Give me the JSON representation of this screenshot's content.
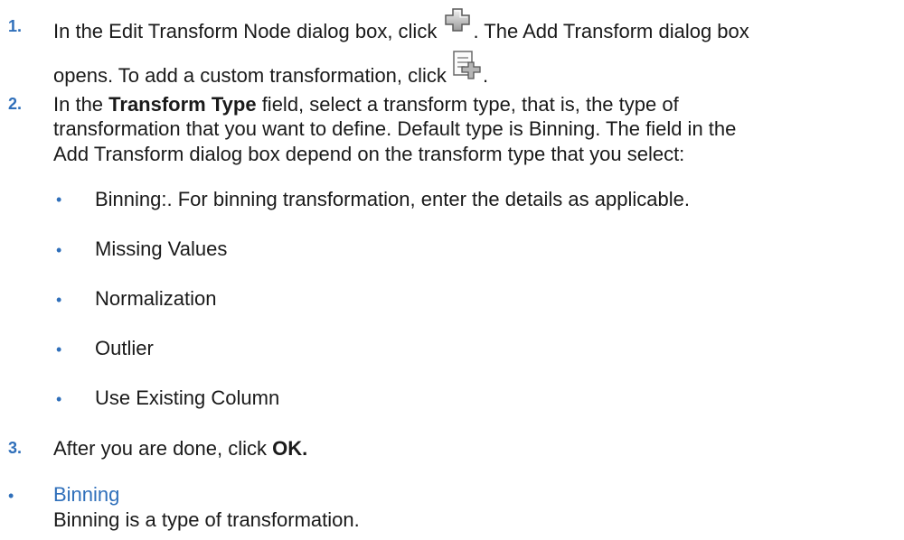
{
  "steps": [
    {
      "num": "1.",
      "line1_a": "In the Edit Transform Node dialog box, click ",
      "line1_b": ". The Add Transform dialog box",
      "line2_a": "opens. To add a custom transformation, click ",
      "line2_b": "."
    },
    {
      "num": "2.",
      "line1_a": "In the ",
      "line1_bold": "Transform Type",
      "line1_b": " field, select a transform type, that is, the type of",
      "line2": "transformation that you want to define. Default type is Binning. The field in the",
      "line3": "Add Transform dialog box depend on the transform type that you select:",
      "bullets": [
        "Binning:. For binning transformation, enter the details as applicable.",
        "Missing Values",
        "Normalization",
        "Outlier",
        "Use Existing Column"
      ]
    },
    {
      "num": "3.",
      "text_a": "After you are done, click ",
      "text_bold": "OK."
    }
  ],
  "related": {
    "link": "Binning",
    "description": "Binning is a type of transformation."
  },
  "icons": {
    "add": "add-icon",
    "custom_transform": "add-custom-transform-icon"
  }
}
